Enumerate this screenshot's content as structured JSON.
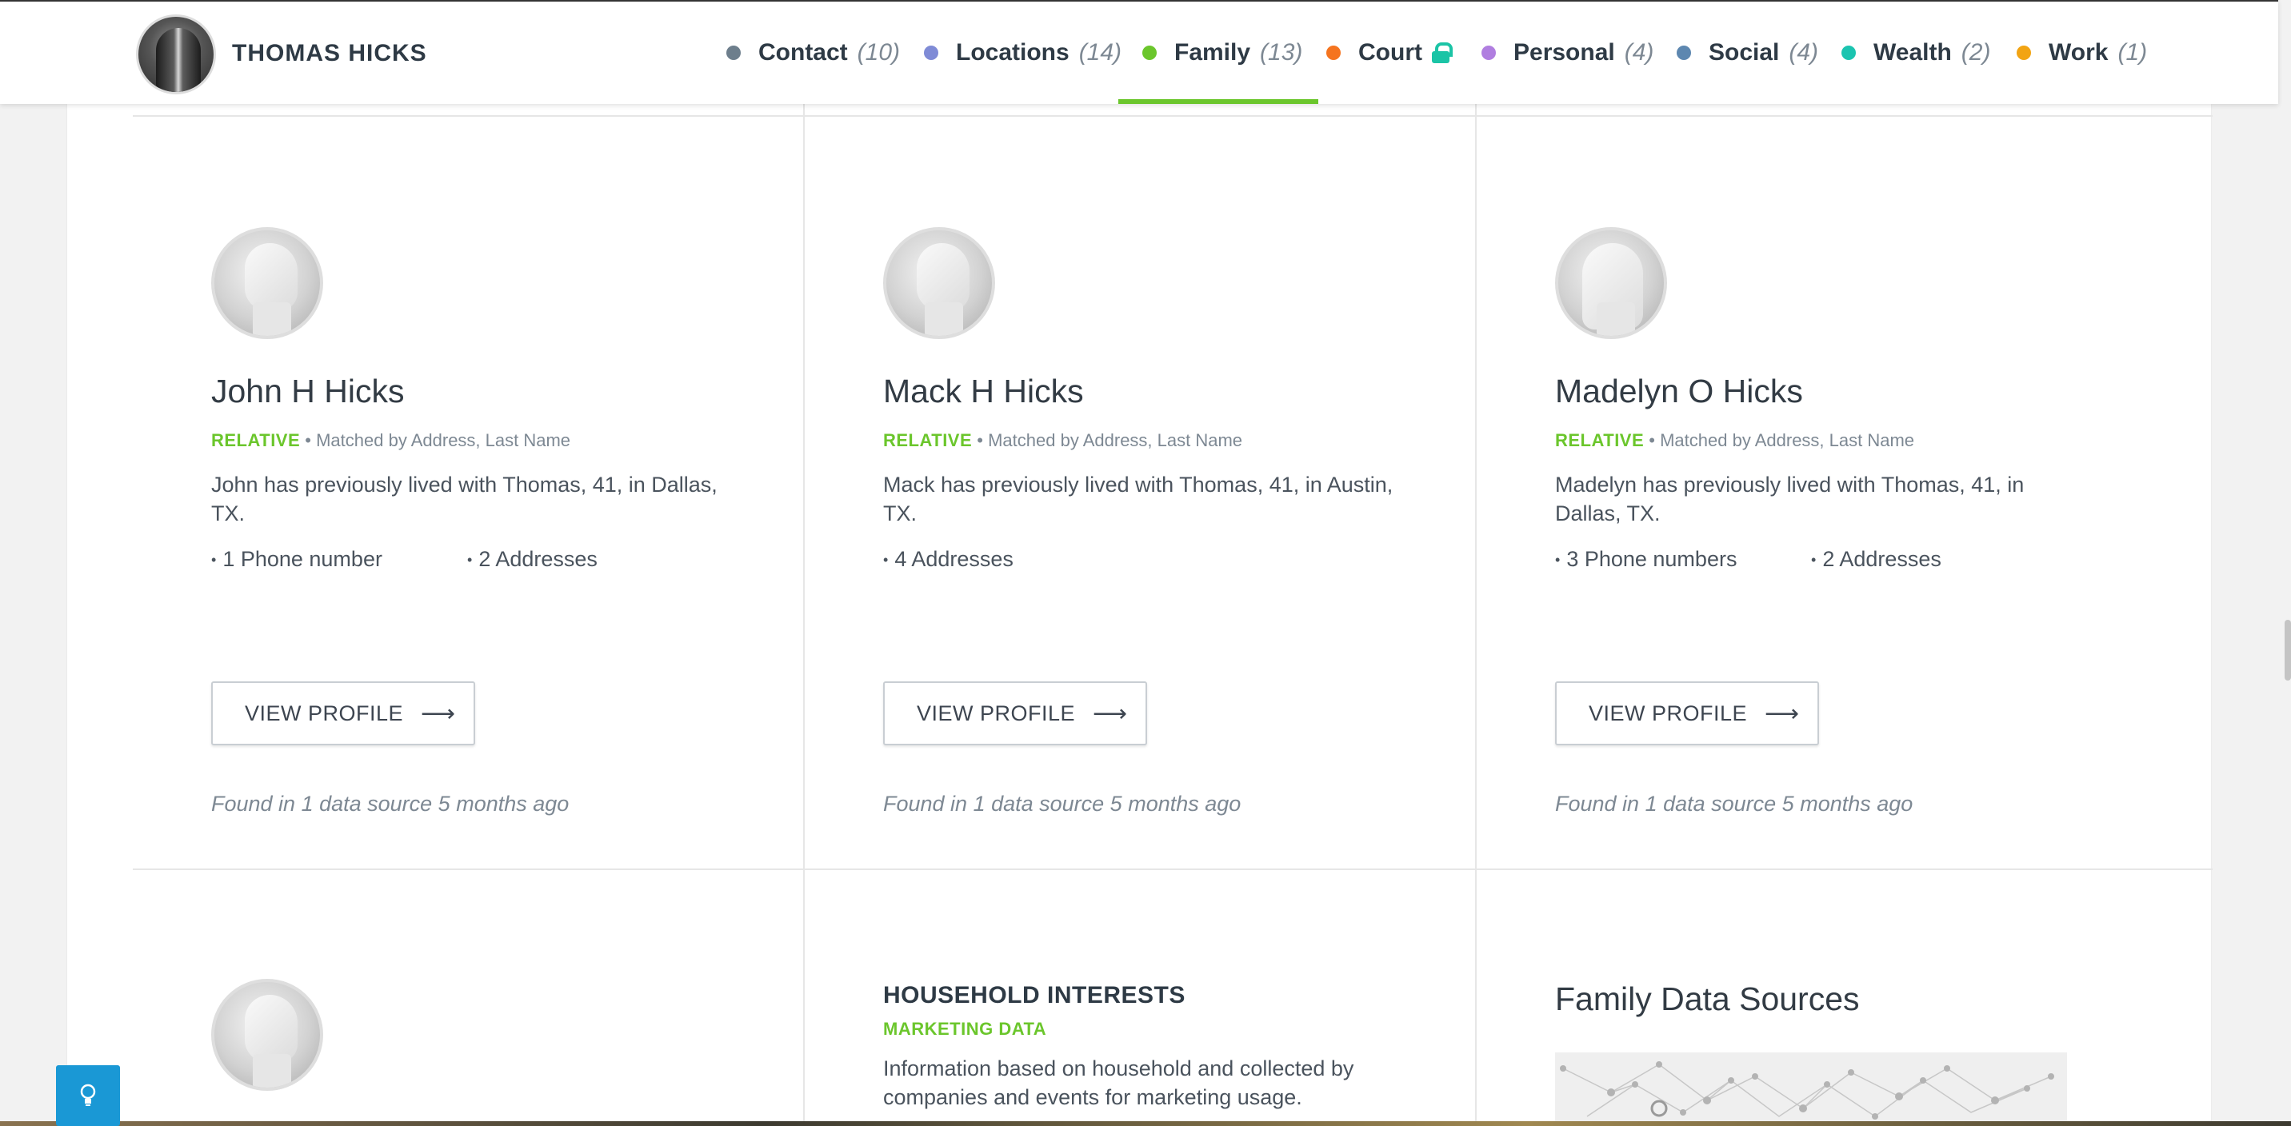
{
  "header": {
    "name": "THOMAS HICKS",
    "nav": [
      {
        "label": "Contact",
        "count": "(10)",
        "color": "#6d7e8c",
        "locked": false
      },
      {
        "label": "Locations",
        "count": "(14)",
        "color": "#7f8bd6",
        "locked": false
      },
      {
        "label": "Family",
        "count": "(13)",
        "color": "#6bc62c",
        "locked": false,
        "active": true
      },
      {
        "label": "Court",
        "count": "",
        "color": "#f5741f",
        "locked": true
      },
      {
        "label": "Personal",
        "count": "(4)",
        "color": "#b07ee0",
        "locked": false
      },
      {
        "label": "Social",
        "count": "(4)",
        "color": "#5d87b0",
        "locked": false
      },
      {
        "label": "Wealth",
        "count": "(2)",
        "color": "#1bc4b0",
        "locked": false
      },
      {
        "label": "Work",
        "count": "(1)",
        "color": "#f2a413",
        "locked": false
      }
    ]
  },
  "relatives": [
    {
      "name": "John H Hicks",
      "relation": "RELATIVE",
      "match": "Matched by Address, Last Name",
      "description": "John has previously lived with Thomas, 41, in Dallas, TX.",
      "facts": [
        "1 Phone number",
        "2 Addresses"
      ],
      "button": "VIEW PROFILE",
      "found": "Found in 1 data source 5 months ago"
    },
    {
      "name": "Mack H Hicks",
      "relation": "RELATIVE",
      "match": "Matched by Address, Last Name",
      "description": "Mack has previously lived with Thomas, 41, in Austin, TX.",
      "facts": [
        "4 Addresses"
      ],
      "button": "VIEW PROFILE",
      "found": "Found in 1 data source 5 months ago"
    },
    {
      "name": "Madelyn O Hicks",
      "relation": "RELATIVE",
      "match": "Matched by Address, Last Name",
      "description": "Madelyn has previously lived with Thomas, 41, in Dallas, TX.",
      "facts": [
        "3 Phone numbers",
        "2 Addresses"
      ],
      "button": "VIEW PROFILE",
      "found": "Found in 1 data source 5 months ago"
    }
  ],
  "household": {
    "title": "HOUSEHOLD INTERESTS",
    "subtitle": "MARKETING DATA",
    "description": "Information based on household and collected by companies and events for marketing usage."
  },
  "family_sources": {
    "title": "Family Data Sources"
  }
}
